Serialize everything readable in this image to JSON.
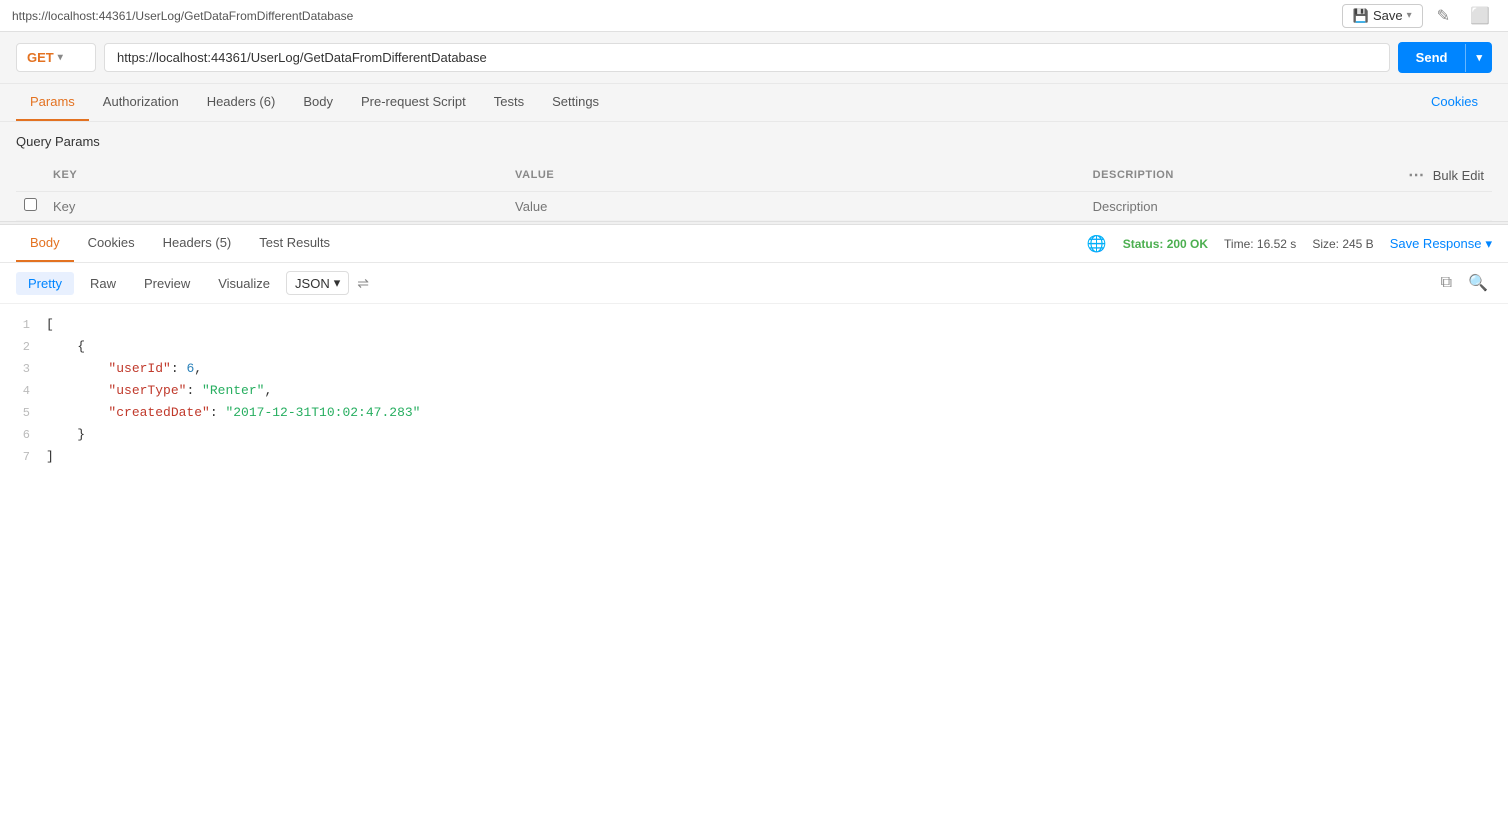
{
  "topbar": {
    "url": "https://localhost:44361/UserLog/GetDataFromDifferentDatabase",
    "save_label": "Save",
    "save_chevron": "▾",
    "edit_icon": "✎",
    "window_icon": "⬜"
  },
  "request": {
    "method": "GET",
    "url": "https://localhost:44361/UserLog/GetDataFromDifferentDatabase",
    "send_label": "Send",
    "send_chevron": "▾",
    "tabs": [
      {
        "id": "params",
        "label": "Params",
        "active": true
      },
      {
        "id": "authorization",
        "label": "Authorization",
        "active": false
      },
      {
        "id": "headers",
        "label": "Headers (6)",
        "active": false
      },
      {
        "id": "body",
        "label": "Body",
        "active": false
      },
      {
        "id": "pre-request-script",
        "label": "Pre-request Script",
        "active": false
      },
      {
        "id": "tests",
        "label": "Tests",
        "active": false
      },
      {
        "id": "settings",
        "label": "Settings",
        "active": false
      }
    ],
    "cookies_label": "Cookies"
  },
  "query_params": {
    "title": "Query Params",
    "columns": {
      "key": "KEY",
      "value": "VALUE",
      "description": "DESCRIPTION"
    },
    "placeholder_key": "Key",
    "placeholder_value": "Value",
    "placeholder_description": "Description",
    "bulk_edit_label": "Bulk Edit"
  },
  "response": {
    "tabs": [
      {
        "id": "body",
        "label": "Body",
        "active": true
      },
      {
        "id": "cookies",
        "label": "Cookies",
        "active": false
      },
      {
        "id": "headers",
        "label": "Headers (5)",
        "active": false
      },
      {
        "id": "test-results",
        "label": "Test Results",
        "active": false
      }
    ],
    "status": {
      "text": "Status: 200 OK",
      "time": "Time: 16.52 s",
      "size": "Size: 245 B"
    },
    "save_response_label": "Save Response",
    "save_response_chevron": "▾",
    "format_tabs": [
      {
        "id": "pretty",
        "label": "Pretty",
        "active": true
      },
      {
        "id": "raw",
        "label": "Raw",
        "active": false
      },
      {
        "id": "preview",
        "label": "Preview",
        "active": false
      },
      {
        "id": "visualize",
        "label": "Visualize",
        "active": false
      }
    ],
    "format_select": "JSON",
    "code_lines": [
      {
        "num": 1,
        "tokens": [
          {
            "type": "bracket",
            "text": "["
          }
        ]
      },
      {
        "num": 2,
        "tokens": [
          {
            "type": "bracket",
            "text": "    {"
          }
        ]
      },
      {
        "num": 3,
        "tokens": [
          {
            "type": "key",
            "text": "        \"userId\""
          },
          {
            "type": "colon",
            "text": ": "
          },
          {
            "type": "num",
            "text": "6"
          },
          {
            "type": "comma",
            "text": ","
          }
        ]
      },
      {
        "num": 4,
        "tokens": [
          {
            "type": "key",
            "text": "        \"userType\""
          },
          {
            "type": "colon",
            "text": ": "
          },
          {
            "type": "str",
            "text": "\"Renter\""
          },
          {
            "type": "comma",
            "text": ","
          }
        ]
      },
      {
        "num": 5,
        "tokens": [
          {
            "type": "key",
            "text": "        \"createdDate\""
          },
          {
            "type": "colon",
            "text": ": "
          },
          {
            "type": "str",
            "text": "\"2017-12-31T10:02:47.283\""
          }
        ]
      },
      {
        "num": 6,
        "tokens": [
          {
            "type": "bracket",
            "text": "    }"
          }
        ]
      },
      {
        "num": 7,
        "tokens": [
          {
            "type": "bracket",
            "text": "]"
          }
        ]
      }
    ]
  }
}
